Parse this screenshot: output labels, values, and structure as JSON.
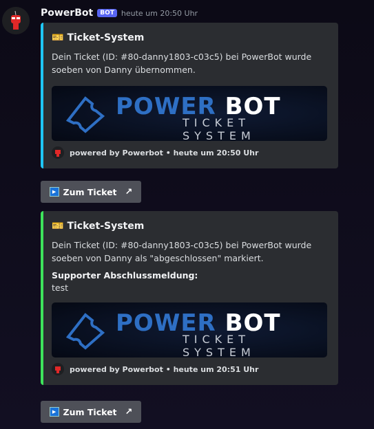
{
  "author": {
    "name": "PowerBot",
    "badge": "BOT",
    "timestamp": "heute um 20:50 Uhr"
  },
  "embeds": [
    {
      "title": "Ticket-System",
      "description": "Dein Ticket (ID: #80-danny1803-c03c5) bei PowerBot wurde soeben von Danny übernommen.",
      "banner": {
        "brand": "POWER",
        "brand2": "BOT",
        "subtitle": "TICKET SYSTEM"
      },
      "footer": "powered by Powerbot • heute um 20:50 Uhr",
      "accent": "#1fc6f5"
    },
    {
      "title": "Ticket-System",
      "description": "Dein Ticket (ID: #80-danny1803-c03c5) bei PowerBot wurde soeben von Danny als \"abgeschlossen\" markiert.",
      "field_name": "Supporter Abschlussmeldung:",
      "field_value": "test",
      "banner": {
        "brand": "POWER",
        "brand2": "BOT",
        "subtitle": "TICKET SYSTEM"
      },
      "footer": "powered by Powerbot • heute um 20:51 Uhr",
      "accent": "#3ee35b"
    }
  ],
  "buttons": [
    {
      "label": "Zum Ticket"
    },
    {
      "label": "Zum Ticket"
    }
  ]
}
